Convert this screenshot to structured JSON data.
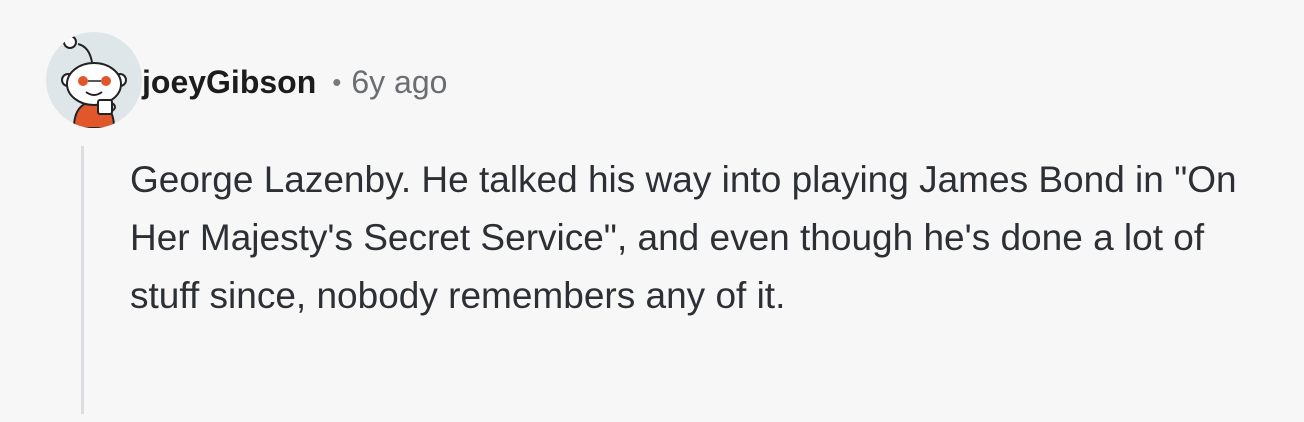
{
  "comment": {
    "username": "joeyGibson",
    "separator": "•",
    "age": "6y ago",
    "body": "George Lazenby. He talked his way into playing James Bond in \"On Her Majesty's Secret Service\", and even though he's done a lot of stuff since, nobody remembers any of it.",
    "avatar_icon": "reddit-snoo-avatar-icon",
    "thread_line_icon": "collapse-thread-line"
  },
  "colors": {
    "background": "#f7f7f8",
    "username": "#1c1c1c",
    "meta_gray": "#6a6d71",
    "body_text": "#2c2f33",
    "thread_line": "#dcdde0",
    "avatar_accent": "#e2562b"
  }
}
